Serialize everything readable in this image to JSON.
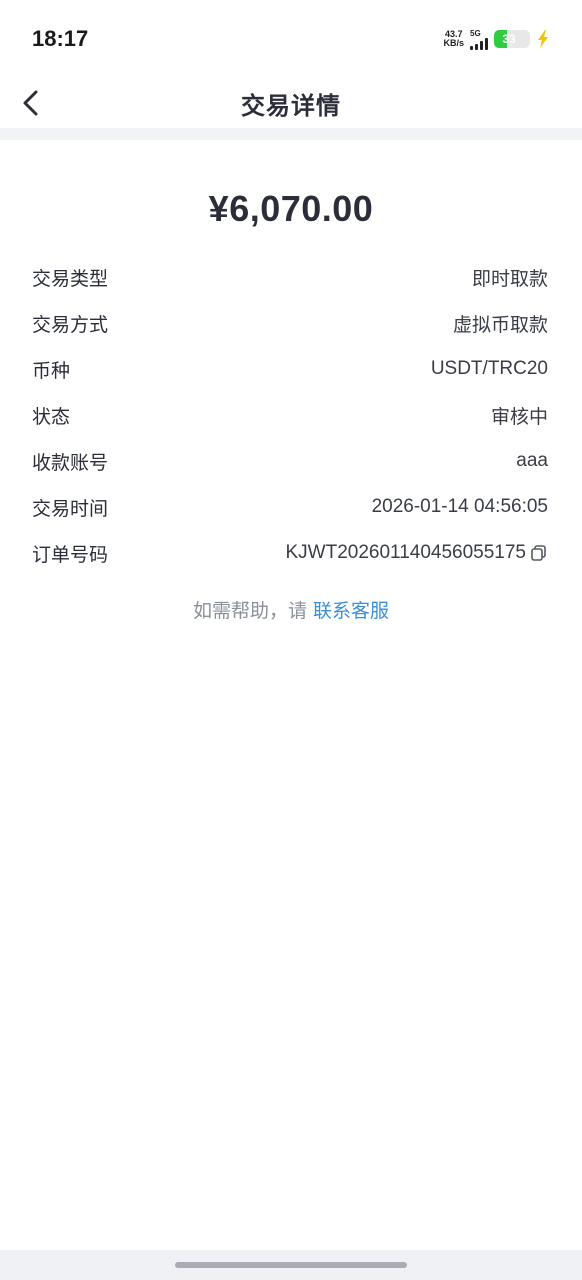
{
  "status_bar": {
    "time": "18:17",
    "net_speed_value": "43.7",
    "net_speed_unit": "KB/s",
    "network_type": "5G",
    "battery_level": "33",
    "battery_color": "#2ecc40",
    "charging_icon": "bolt-icon"
  },
  "header": {
    "back_icon": "chevron-left-icon",
    "title": "交易详情"
  },
  "amount": "¥6,070.00",
  "details": [
    {
      "label": "交易类型",
      "value": "即时取款"
    },
    {
      "label": "交易方式",
      "value": "虚拟币取款"
    },
    {
      "label": "币种",
      "value": "USDT/TRC20"
    },
    {
      "label": "状态",
      "value": "审核中"
    },
    {
      "label": "收款账号",
      "value": "aaa"
    },
    {
      "label": "交易时间",
      "value": "2026-01-14 04:56:05"
    },
    {
      "label": "订单号码",
      "value": "KJWT202601140456055175",
      "icon": "copy-icon"
    }
  ],
  "help": {
    "text": "如需帮助，请",
    "link": "联系客服",
    "link_color": "#3a8fd8"
  }
}
